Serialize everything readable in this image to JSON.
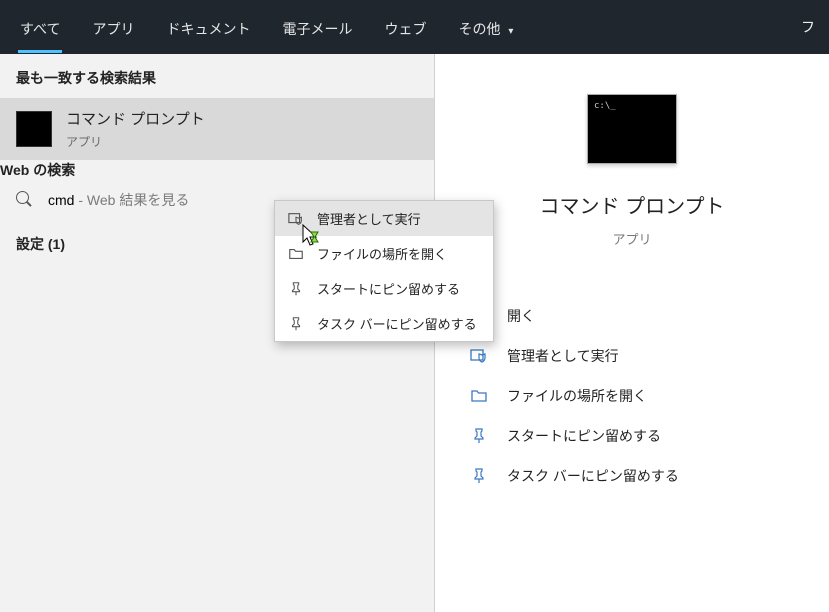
{
  "tabs": {
    "all": "すべて",
    "apps": "アプリ",
    "documents": "ドキュメント",
    "email": "電子メール",
    "web": "ウェブ",
    "more": "その他",
    "right_truncated": "フ"
  },
  "left_panel": {
    "best_match_header": "最も一致する検索結果",
    "result": {
      "title": "コマンド プロンプト",
      "subtitle": "アプリ"
    },
    "web_header": "Web の検索",
    "web_query": "cmd",
    "web_suffix": " - Web 結果を見る",
    "settings_header": "設定 (1)"
  },
  "context_menu": {
    "run_admin": "管理者として実行",
    "open_location": "ファイルの場所を開く",
    "pin_start": "スタートにピン留めする",
    "pin_taskbar": "タスク バーにピン留めする"
  },
  "right_panel": {
    "title": "コマンド プロンプト",
    "subtitle": "アプリ",
    "actions": {
      "open": "開く",
      "run_admin": "管理者として実行",
      "open_location": "ファイルの場所を開く",
      "pin_start": "スタートにピン留めする",
      "pin_taskbar": "タスク バーにピン留めする"
    }
  }
}
